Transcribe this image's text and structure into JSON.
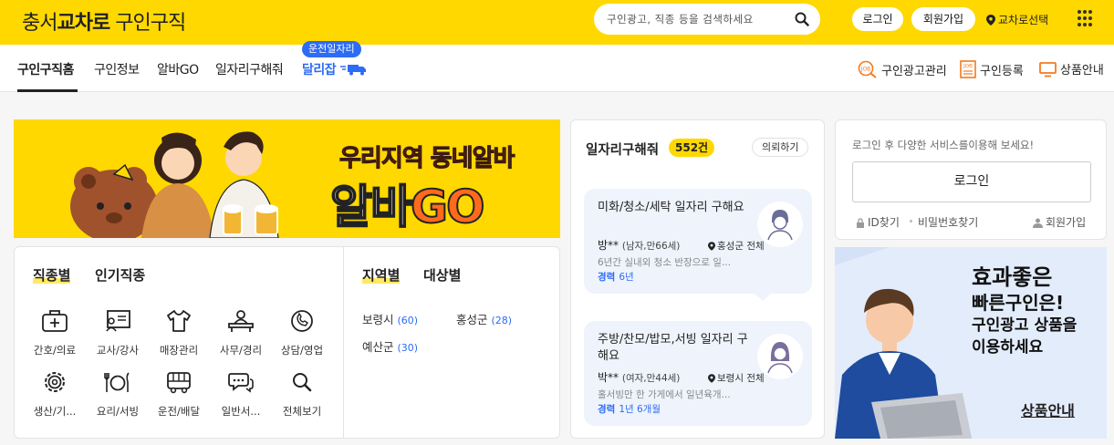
{
  "header": {
    "logo_region": "충서",
    "logo_brand": "교차로",
    "logo_suffix": "구인구직",
    "search_placeholder": "구인광고, 직종 등을 검색하세요",
    "login_label": "로그인",
    "signup_label": "회원가입",
    "region_select_label": "교차로선택",
    "brand_color": "#ffd800"
  },
  "nav": {
    "items": [
      {
        "label": "구인구직홈"
      },
      {
        "label": "구인정보"
      },
      {
        "label": "알바GO"
      },
      {
        "label": "일자리구해줘"
      },
      {
        "label": "달리잡"
      }
    ],
    "driver_badge": "운전일자리",
    "right": [
      {
        "label": "구인광고관리",
        "icon": "job-search-icon"
      },
      {
        "label": "구인등록",
        "icon": "job-doc-icon"
      },
      {
        "label": "상품안내",
        "icon": "monitor-icon"
      }
    ]
  },
  "banner": {
    "line1": "우리지역 동네알바",
    "line2_a": "알바",
    "line2_b": "GO"
  },
  "categories": {
    "tabs": [
      "직종별",
      "인기직종"
    ],
    "items": [
      {
        "label": "간호/의료",
        "icon": "medical-kit-icon"
      },
      {
        "label": "교사/강사",
        "icon": "teacher-board-icon"
      },
      {
        "label": "매장관리",
        "icon": "shirt-icon"
      },
      {
        "label": "사무/경리",
        "icon": "office-desk-icon"
      },
      {
        "label": "상담/영업",
        "icon": "phone-chat-icon"
      },
      {
        "label": "생산/기...",
        "icon": "gear-icon"
      },
      {
        "label": "요리/서빙",
        "icon": "plate-utensils-icon"
      },
      {
        "label": "운전/배달",
        "icon": "bus-icon"
      },
      {
        "label": "일반서...",
        "icon": "speech-bubbles-icon"
      },
      {
        "label": "전체보기",
        "icon": "search-icon"
      }
    ]
  },
  "regions": {
    "tabs": [
      "지역별",
      "대상별"
    ],
    "items": [
      {
        "name": "보령시",
        "count": "(60)"
      },
      {
        "name": "홍성군",
        "count": "(28)"
      },
      {
        "name": "예산군",
        "count": "(30)"
      }
    ]
  },
  "jobs_wanted": {
    "title": "일자리구해줘",
    "count": "552건",
    "request_label": "의뢰하기",
    "posts": [
      {
        "title": "미화/청소/세탁 일자리 구해요",
        "name": "방**",
        "info": "(남자,만66세)",
        "location": "홍성군 전체",
        "desc": "6년간 실내외 청소 반장으로 일...",
        "exp_label": "경력",
        "exp_value": "6년",
        "avatar": "male-avatar-icon"
      },
      {
        "title": "주방/찬모/밥모,서빙 일자리 구해요",
        "name": "박**",
        "info": "(여자,만44세)",
        "location": "보령시 전체",
        "desc": "홀서빙만 한 가게에서 일년육개...",
        "exp_label": "경력",
        "exp_value": "1년 6개월",
        "avatar": "female-avatar-icon"
      }
    ]
  },
  "login_box": {
    "message": "로그인 후 다양한 서비스를이용해 보세요!",
    "button": "로그인",
    "find_id": "ID찾기",
    "find_pw": "비밀번호찾기",
    "signup": "회원가입"
  },
  "ad": {
    "line1": "효과좋은",
    "line2": "빠른구인은!",
    "line3": "구인광고 상품을",
    "line4": "이용하세요",
    "link": "상품안내"
  }
}
